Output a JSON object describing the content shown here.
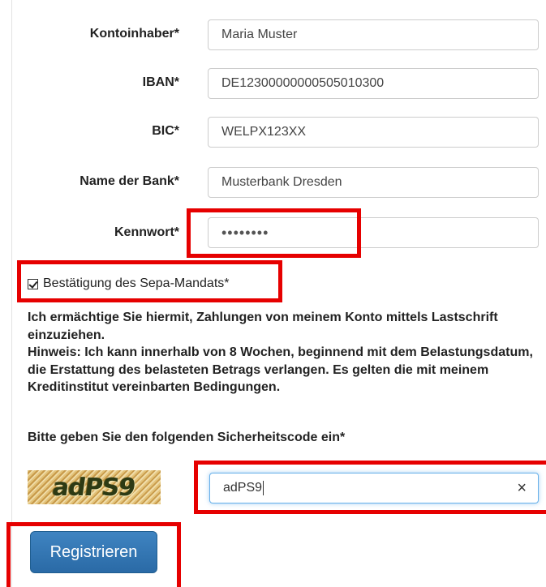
{
  "form": {
    "fields": [
      {
        "label": "Kontoinhaber*",
        "value": "Maria Muster"
      },
      {
        "label": "IBAN*",
        "value": "DE12300000000505010300"
      },
      {
        "label": "BIC*",
        "value": "WELPX123XX"
      },
      {
        "label": "Name der Bank*",
        "value": "Musterbank Dresden"
      },
      {
        "label": "Kennwort*",
        "value": "••••••••"
      }
    ],
    "sepa_checkbox_label": "Bestätigung des Sepa-Mandats*",
    "sepa_checked": true,
    "mandate_text": "Ich ermächtige Sie hiermit, Zahlungen von meinem Konto mittels Lastschrift einzuziehen.",
    "notice_text": "Hinweis: Ich kann innerhalb von 8 Wochen, beginnend mit dem Belastungsdatum, die Erstattung des belasteten Betrags verlangen. Es gelten die mit meinem Kreditinstitut vereinbarten Bedingungen.",
    "security_label": "Bitte geben Sie den folgenden Sicherheitscode ein*",
    "captcha_image_text": "adPS9",
    "captcha_input_value": "adPS9",
    "clear_icon": "×",
    "register_label": "Registrieren"
  },
  "colors": {
    "highlight": "#e60000",
    "button": "#2f74b5",
    "focus_border": "#66afe9"
  }
}
